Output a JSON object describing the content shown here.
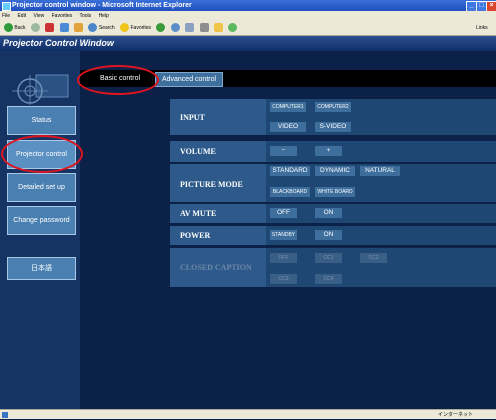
{
  "window": {
    "title": "Projector control window - Microsoft Internet Explorer",
    "minimize": "_",
    "maximize": "□",
    "close": "×"
  },
  "menu": [
    "File",
    "Edit",
    "View",
    "Favorites",
    "Tools",
    "Help"
  ],
  "toolbar": {
    "back": "Back",
    "search": "Search",
    "favorites": "Favorites",
    "links": "Links"
  },
  "page_title": "Projector Control Window",
  "sidebar": {
    "status": "Status",
    "projector_control": "Projector control",
    "detailed_setup": "Detailed set up",
    "change_password": "Change password",
    "language": "日本語"
  },
  "tabs": {
    "basic": "Basic control",
    "advanced": "Advanced control"
  },
  "controls": {
    "input": {
      "label": "INPUT",
      "computer1": "COMPUTER1",
      "computer2": "COMPUTER2",
      "video": "VIDEO",
      "svideo": "S-VIDEO"
    },
    "volume": {
      "label": "VOLUME",
      "minus": "−",
      "plus": "+"
    },
    "picture_mode": {
      "label": "PICTURE MODE",
      "standard": "STANDARD",
      "dynamic": "DYNAMIC",
      "natural": "NATURAL",
      "blackboard": "BLACKBOARD",
      "whiteboard": "WHITE BOARD"
    },
    "av_mute": {
      "label": "AV MUTE",
      "off": "OFF",
      "on": "ON"
    },
    "power": {
      "label": "POWER",
      "standby": "STANDBY",
      "on": "ON"
    },
    "closed_caption": {
      "label": "CLOSED CAPTION",
      "off": "OFF",
      "cc1": "CC1",
      "cc2": "CC2",
      "cc3": "CC3",
      "cc4": "CC4"
    }
  },
  "status_bar": {
    "zone": "インターネット"
  },
  "colors": {
    "annotation": "#e0141e",
    "sidebar_button": "#4a7fb1",
    "panel_label": "#2d5a8a"
  }
}
